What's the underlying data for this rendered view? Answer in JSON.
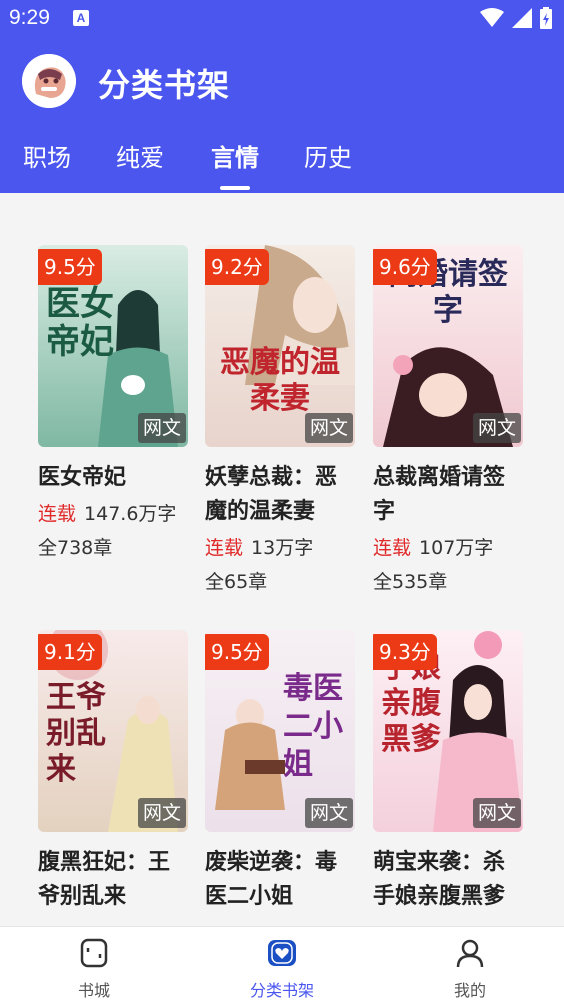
{
  "status_bar": {
    "time": "9:29",
    "a_icon": "A"
  },
  "header": {
    "title": "分类书架",
    "logo_icon": "app-logo-icon"
  },
  "tabs": [
    {
      "label": "职场",
      "active": false
    },
    {
      "label": "纯爱",
      "active": false
    },
    {
      "label": "言情",
      "active": true
    },
    {
      "label": "历史",
      "active": false
    }
  ],
  "books": [
    {
      "score": "9.5分",
      "tag": "网文",
      "cover_text": "医女帝妃",
      "title": "医女帝妃",
      "status": "连载",
      "words": "147.6万字",
      "chapters": "全738章"
    },
    {
      "score": "9.2分",
      "tag": "网文",
      "cover_text": "恶魔的温柔妻",
      "title": "妖孽总裁：恶魔的温柔妻",
      "status": "连载",
      "words": "13万字",
      "chapters": "全65章"
    },
    {
      "score": "9.6分",
      "tag": "网文",
      "cover_text": "离婚请签字",
      "title": "总裁离婚请签字",
      "status": "连载",
      "words": "107万字",
      "chapters": "全535章"
    },
    {
      "score": "9.1分",
      "tag": "网文",
      "cover_text": "王爷别乱来",
      "title": "腹黑狂妃：王爷别乱来",
      "status": "",
      "words": "",
      "chapters": ""
    },
    {
      "score": "9.5分",
      "tag": "网文",
      "cover_text": "毒医二小姐",
      "title": "废柴逆袭：毒医二小姐",
      "status": "",
      "words": "",
      "chapters": ""
    },
    {
      "score": "9.3分",
      "tag": "网文",
      "cover_text": "手娘亲腹黑爹",
      "title": "萌宝来袭：杀手娘亲腹黑爹",
      "status": "",
      "words": "",
      "chapters": ""
    }
  ],
  "bottom_nav": [
    {
      "label": "书城",
      "icon": "bookstore-icon",
      "active": false
    },
    {
      "label": "分类书架",
      "icon": "bookshelf-heart-icon",
      "active": true
    },
    {
      "label": "我的",
      "icon": "profile-icon",
      "active": false
    }
  ],
  "colors": {
    "primary": "#4a56ee",
    "score_bg": "#ec3a16",
    "serial_red": "#e02a2a"
  }
}
